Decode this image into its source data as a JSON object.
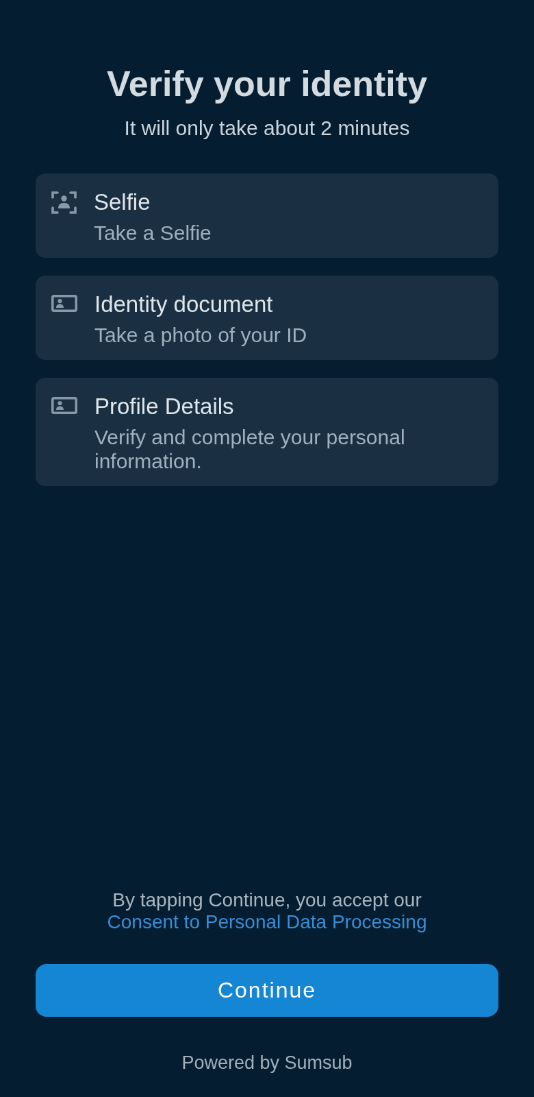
{
  "header": {
    "title": "Verify your identity",
    "subtitle": "It will only take about 2 minutes"
  },
  "steps": [
    {
      "kind": "selfie",
      "title": "Selfie",
      "description": "Take a Selfie"
    },
    {
      "kind": "document",
      "title": "Identity document",
      "description": "Take a photo of your ID"
    },
    {
      "kind": "document",
      "title": "Profile Details",
      "description": "Verify and complete your personal information."
    }
  ],
  "consent": {
    "text": "By tapping Continue, you accept our",
    "link": "Consent to Personal Data Processing"
  },
  "primary_button": {
    "label": "Continue"
  },
  "footer": {
    "text": "Powered by Sumsub"
  }
}
